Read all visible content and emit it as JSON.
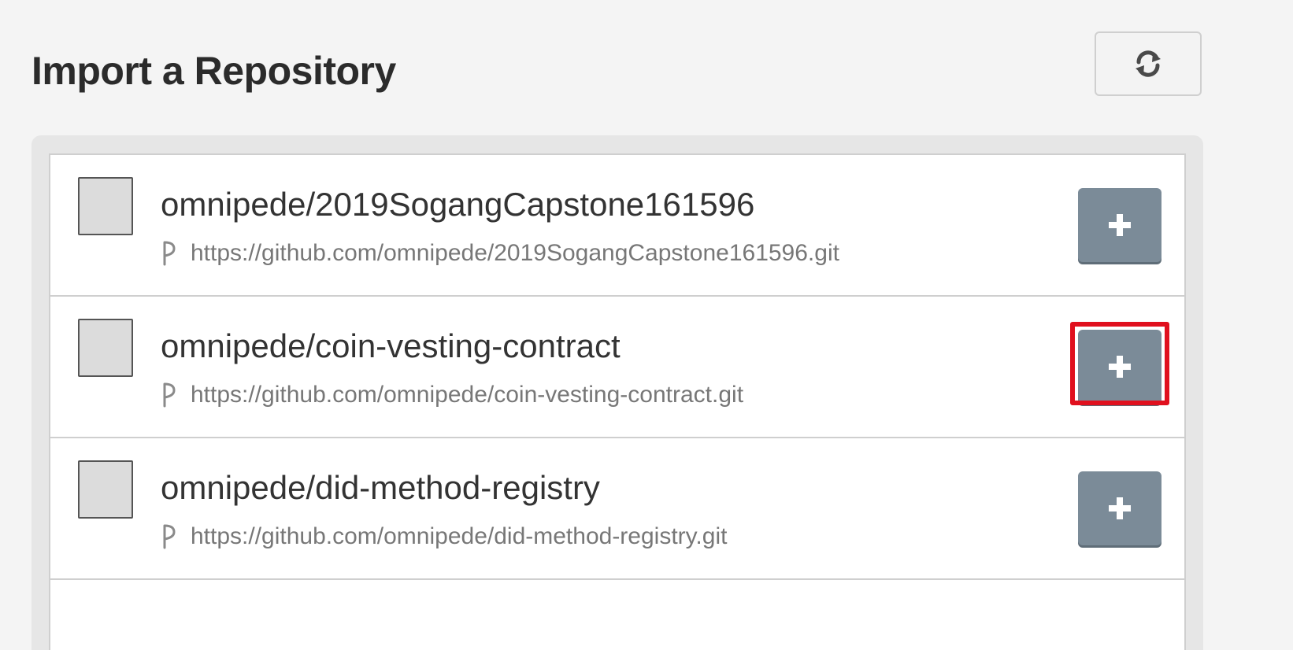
{
  "header": {
    "title": "Import a Repository",
    "refresh_icon": "refresh-icon"
  },
  "repositories": [
    {
      "name": "omnipede/2019SogangCapstone161596",
      "url": "https://github.com/omnipede/2019SogangCapstone161596.git",
      "highlighted": false
    },
    {
      "name": "omnipede/coin-vesting-contract",
      "url": "https://github.com/omnipede/coin-vesting-contract.git",
      "highlighted": true
    },
    {
      "name": "omnipede/did-method-registry",
      "url": "https://github.com/omnipede/did-method-registry.git",
      "highlighted": false
    }
  ],
  "icons": {
    "fork": "fork-icon",
    "add": "plus-icon"
  },
  "colors": {
    "add_button": "#7b8b98",
    "highlight": "#e0101e"
  }
}
